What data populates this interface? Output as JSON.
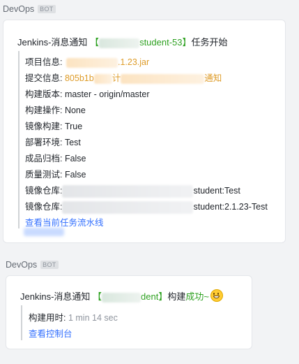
{
  "messages": [
    {
      "sender": "DevOps",
      "badge": "BOT",
      "title_prefix": "Jenkins-消息通知",
      "bracket_open": "【",
      "project_suffix": "student-53",
      "bracket_close": "】",
      "title_suffix": "任务开始",
      "rows": {
        "project_label": "项目信息:",
        "project_value": ".1.23.jar",
        "commit_label": "提交信息:",
        "commit_value_a": "805b1b",
        "commit_value_b": "计",
        "commit_value_c": "通知",
        "version": "构建版本: master - origin/master",
        "operation": "构建操作: None",
        "image_build_label": "镜像构建: ",
        "image_build_value": "True",
        "env": "部署环境: Test",
        "archive": "成品归档: False",
        "qa": "质量测试: False",
        "repo1_label": "镜像仓库:",
        "repo1_value": "student:Test",
        "repo2_label": "镜像仓库:",
        "repo2_value": "student:2.1.23-Test"
      },
      "link": "查看当前任务流水线"
    },
    {
      "sender": "DevOps",
      "badge": "BOT",
      "title_prefix": "Jenkins-消息通知 ",
      "bracket_open": "【",
      "project_suffix": "dent",
      "bracket_close": "】",
      "title_mid": "构建",
      "status": "成功~",
      "emoji": "grinning-face",
      "duration_label": "构建用时:",
      "duration_value": "1 min 14 sec",
      "link": "查看控制台"
    }
  ],
  "colors": {
    "success": "#2ea121",
    "link": "#3370ff",
    "commit": "#de9b27"
  }
}
